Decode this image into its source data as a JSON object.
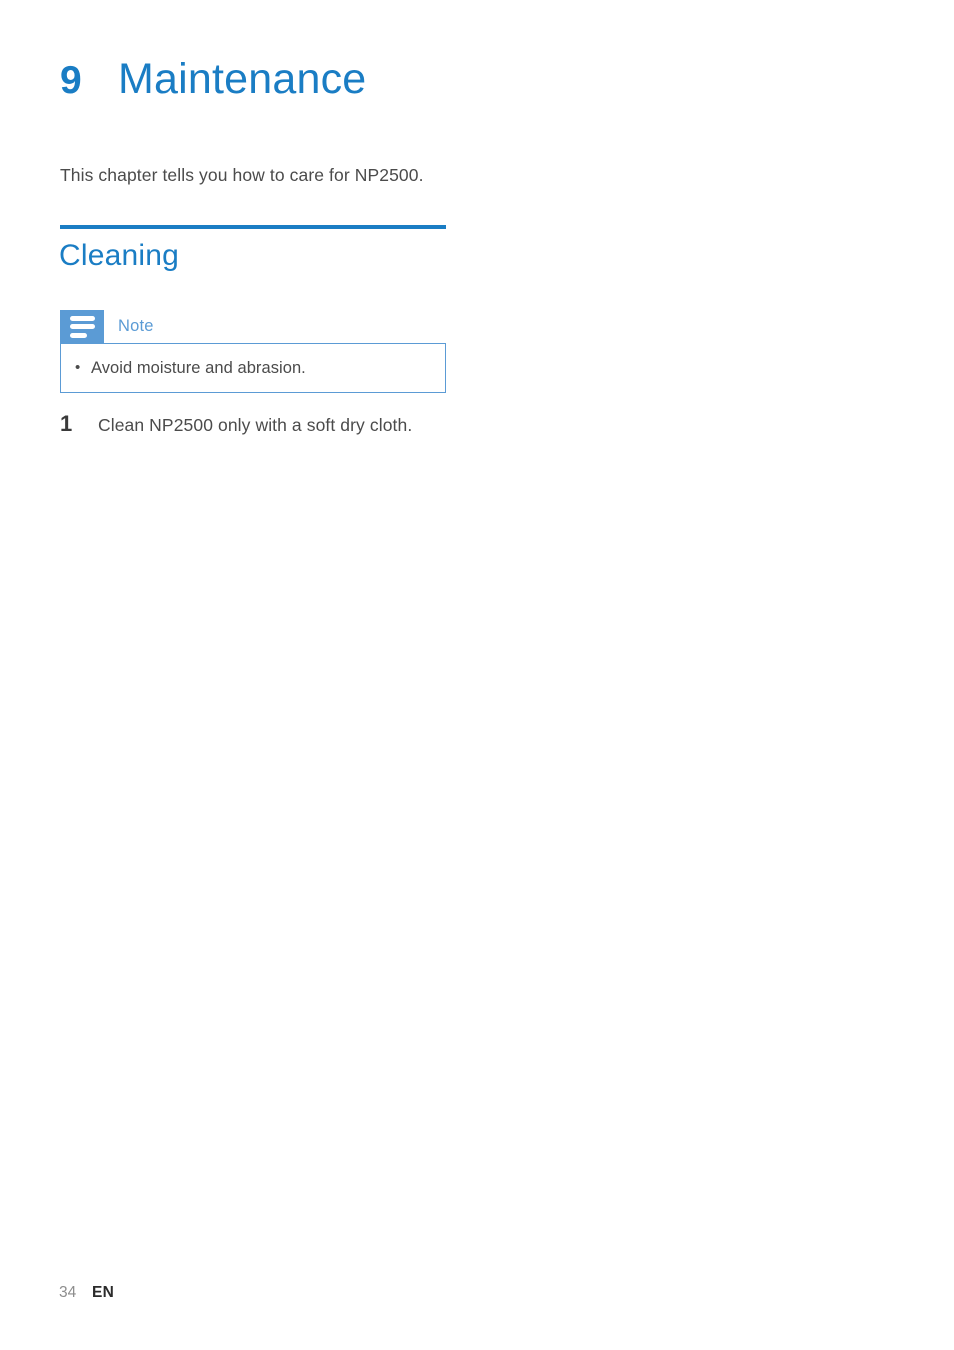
{
  "chapter": {
    "number": "9",
    "title": "Maintenance",
    "intro": "This chapter tells you how to care for NP2500."
  },
  "section": {
    "heading": "Cleaning"
  },
  "note": {
    "icon_name": "note-lines-icon",
    "label": "Note",
    "items": [
      "Avoid moisture and abrasion."
    ],
    "bullet": "•"
  },
  "steps": [
    {
      "number": "1",
      "text": "Clean NP2500 only with a soft dry cloth."
    }
  ],
  "footer": {
    "page_number": "34",
    "language": "EN"
  },
  "colors": {
    "heading_blue": "#1a7dc4",
    "rule_blue": "#1a7dc4",
    "note_blue": "#5b9bd5",
    "body_text": "#4b4b4b",
    "footer_muted": "#8d8d8d",
    "page_background": "#ffffff"
  }
}
